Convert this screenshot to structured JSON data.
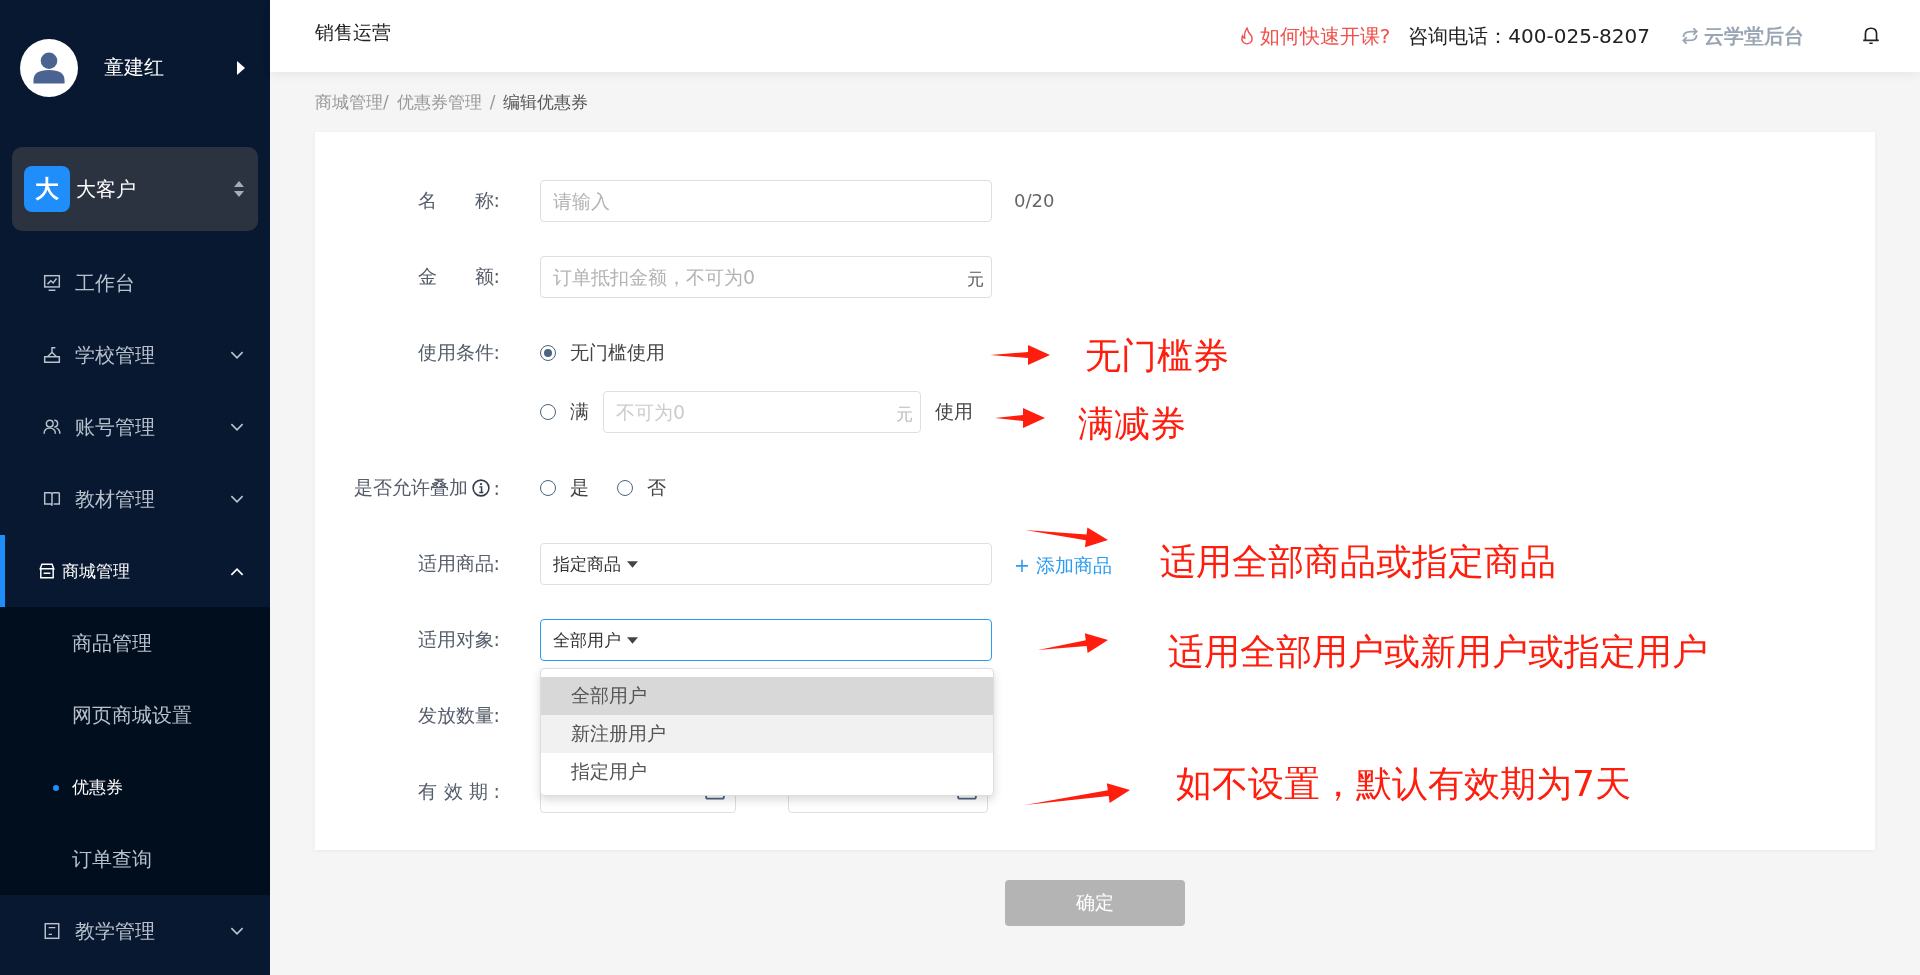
{
  "sidebar": {
    "user": {
      "name": "童建红"
    },
    "org": {
      "badge": "大",
      "name": "大客户"
    },
    "menu": [
      {
        "label": "工作台",
        "selected": false
      },
      {
        "label": "学校管理",
        "expanded": false,
        "selected": false
      },
      {
        "label": "账号管理",
        "expanded": false,
        "selected": false
      },
      {
        "label": "教材管理",
        "expanded": false,
        "selected": false
      },
      {
        "label": "商城管理",
        "expanded": true,
        "selected": true,
        "children": [
          {
            "label": "商品管理",
            "selected": false
          },
          {
            "label": "网页商城设置",
            "selected": false
          },
          {
            "label": "优惠券",
            "selected": true
          },
          {
            "label": "订单查询",
            "selected": false
          }
        ]
      },
      {
        "label": "教学管理",
        "expanded": false,
        "selected": false
      }
    ]
  },
  "header": {
    "title": "销售运营",
    "help_link": "如何快速开课?",
    "hotline": "咨询电话：400-025-8207",
    "brand": "云学堂后台"
  },
  "breadcrumb": [
    "商城管理/",
    "优惠券管理",
    "/",
    "编辑优惠券"
  ],
  "form": {
    "rows": [
      {
        "kind": "text",
        "label": "名　　称:",
        "placeholder": "请输入",
        "counter": "0/20"
      },
      {
        "kind": "text",
        "label": "金　　额:",
        "placeholder": "订单抵扣金额，不可为0",
        "suffix": "元"
      },
      {
        "kind": "radio-stack",
        "label": "使用条件:",
        "options": [
          {
            "label": "无门槛使用",
            "selected": true
          },
          {
            "label": "满",
            "selected": false,
            "placeholder": "不可为0",
            "suffix": "元",
            "after": "使用"
          }
        ]
      },
      {
        "kind": "radio-inline",
        "label": "是否允许叠加",
        "info": true,
        "colon": ":",
        "options": [
          {
            "label": "是",
            "selected": false
          },
          {
            "label": "否",
            "selected": false
          }
        ]
      },
      {
        "kind": "select",
        "label": "适用商品:",
        "value": "指定商品",
        "focused": false,
        "link": "+ 添加商品"
      },
      {
        "kind": "select",
        "label": "适用对象:",
        "value": "全部用户",
        "focused": true,
        "dropdown": [
          {
            "label": "全部用户",
            "selected": true,
            "hovered": false
          },
          {
            "label": "新注册用户",
            "selected": false,
            "hovered": true
          },
          {
            "label": "指定用户",
            "selected": false,
            "hovered": false
          }
        ]
      },
      {
        "kind": "hidden",
        "label": "发放数量:"
      },
      {
        "kind": "date-range",
        "label": "有 效 期 :"
      }
    ],
    "submit": {
      "label": "确定",
      "disabled": true
    }
  },
  "annotations": [
    {
      "text": "无门槛券"
    },
    {
      "text": "满减券"
    },
    {
      "text": "适用全部商品或指定商品"
    },
    {
      "text": "适用全部用户或新用户或指定用户"
    },
    {
      "text": "如不设置，默认有效期为7天"
    }
  ]
}
